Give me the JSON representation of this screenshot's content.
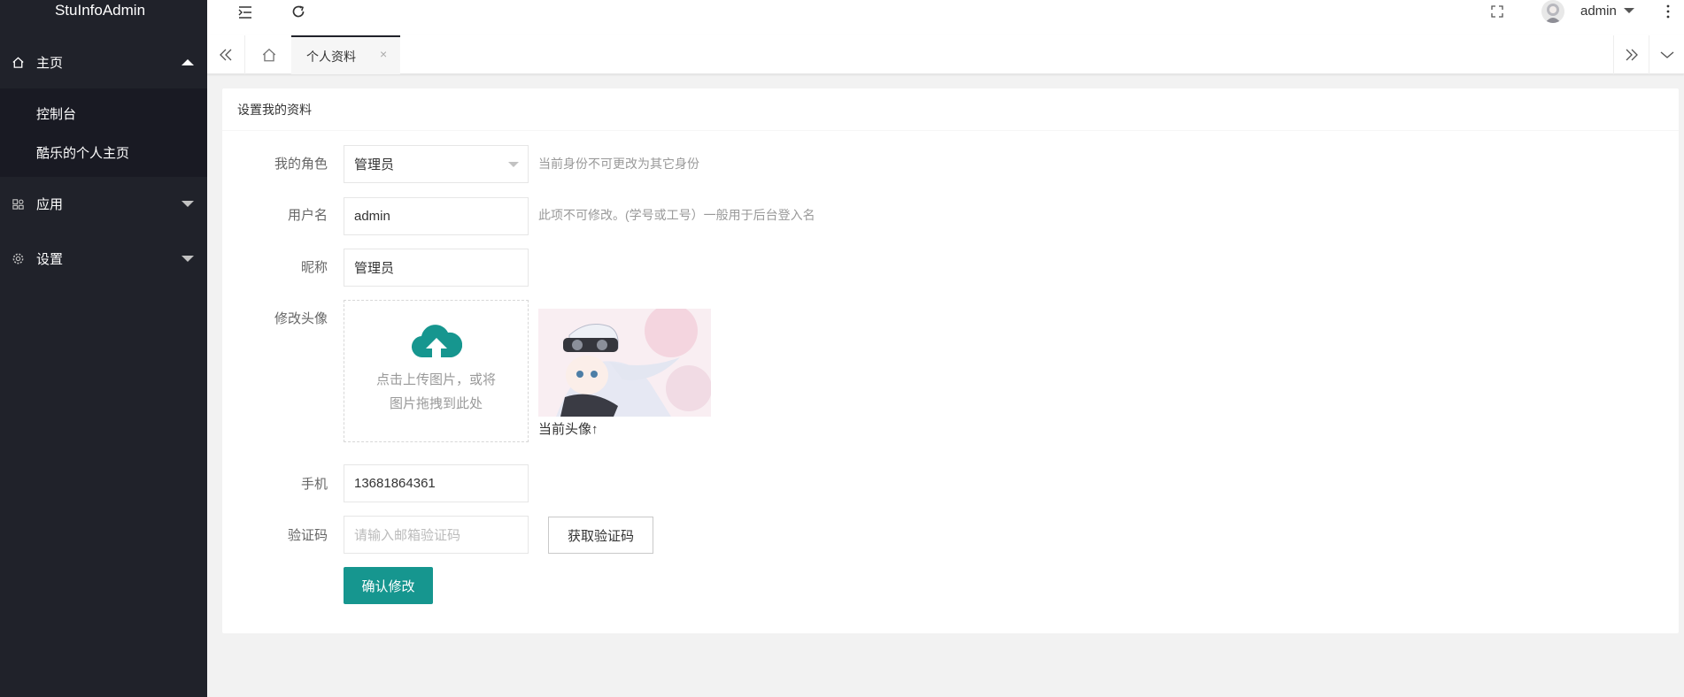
{
  "app": {
    "title": "StuInfoAdmin"
  },
  "sidebar": {
    "home": {
      "label": "主页"
    },
    "home_items": [
      {
        "label": "控制台"
      },
      {
        "label": "酷乐的个人主页"
      }
    ],
    "apps": {
      "label": "应用"
    },
    "settings": {
      "label": "设置"
    }
  },
  "header": {
    "user": "admin"
  },
  "tabs": {
    "active_label": "个人资料",
    "close_glyph": "×"
  },
  "form": {
    "card_title": "设置我的资料",
    "role": {
      "label": "我的角色",
      "value": "管理员",
      "hint": "当前身份不可更改为其它身份"
    },
    "username": {
      "label": "用户名",
      "value": "admin",
      "hint": "此项不可修改。(学号或工号）一般用于后台登入名"
    },
    "nickname": {
      "label": "昵称",
      "value": "管理员"
    },
    "avatar": {
      "label": "修改头像",
      "upload_text_1": "点击上传图片，或将",
      "upload_text_2": "图片拖拽到此处",
      "current_caption": "当前头像↑"
    },
    "phone": {
      "label": "手机",
      "value": "13681864361"
    },
    "code": {
      "label": "验证码",
      "placeholder": "请输入邮箱验证码",
      "get_code_button": "获取验证码"
    },
    "submit_button": "确认修改"
  },
  "colors": {
    "sidebar_bg": "#20222a",
    "submenu_bg": "#191a23",
    "primary": "#16968f",
    "page_bg": "#f2f2f2"
  }
}
